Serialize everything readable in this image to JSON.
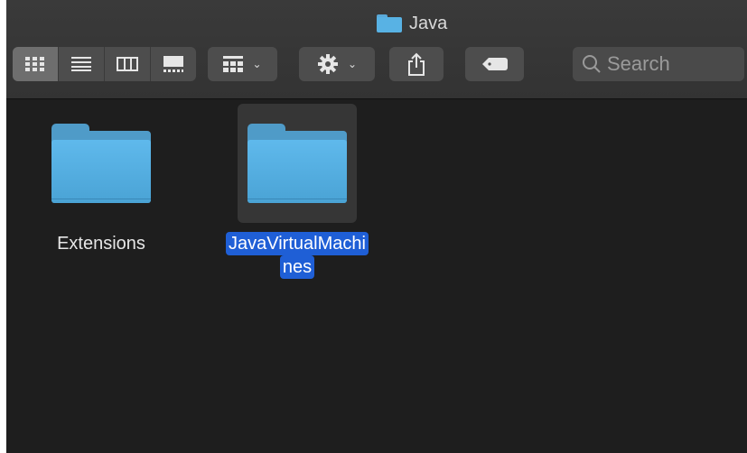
{
  "window": {
    "title": "Java",
    "title_icon": "folder-icon"
  },
  "toolbar": {
    "view_buttons": [
      {
        "name": "icon-view",
        "active": true
      },
      {
        "name": "list-view",
        "active": false
      },
      {
        "name": "column-view",
        "active": false
      },
      {
        "name": "gallery-view",
        "active": false
      }
    ],
    "group_button_icon": "group-grid-icon",
    "action_button_icon": "gear-icon",
    "share_button_icon": "share-icon",
    "tags_button_icon": "tag-icon",
    "search": {
      "placeholder": "Search",
      "icon": "search-icon"
    }
  },
  "files": [
    {
      "name": "Extensions",
      "selected": false
    },
    {
      "name": "JavaVirtualMachines",
      "label_line1": "JavaVirtualMachi",
      "label_line2": "nes",
      "selected": true
    }
  ],
  "colors": {
    "selection": "#1f5fd6",
    "folder": "#58b2e4",
    "background": "#1e1e1e"
  }
}
